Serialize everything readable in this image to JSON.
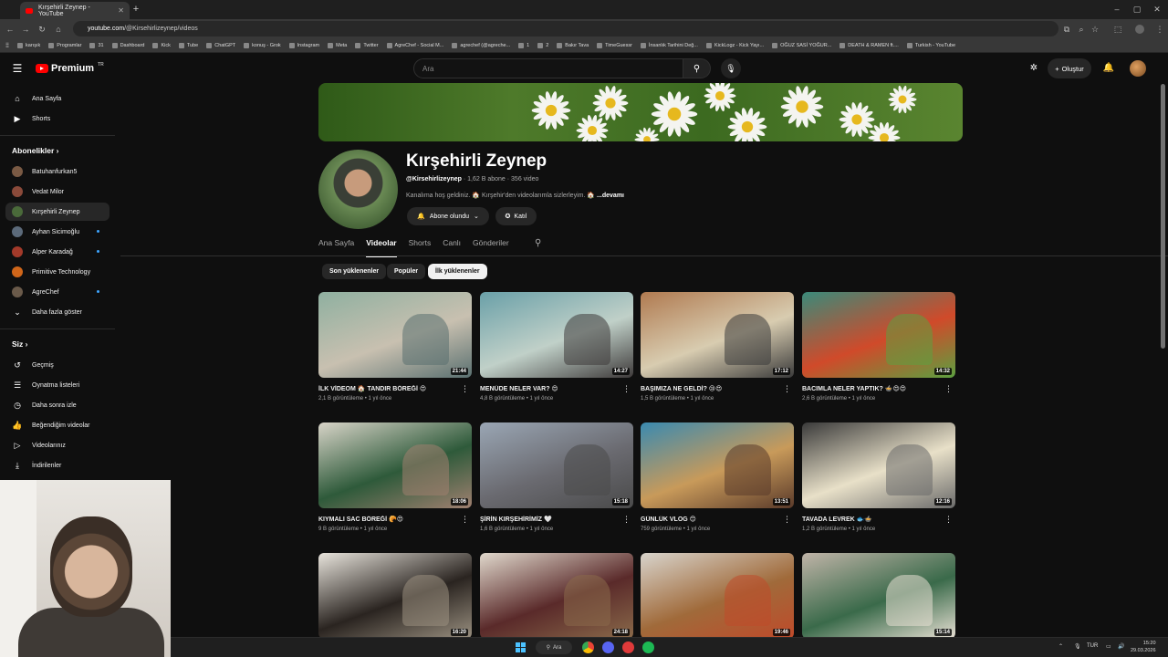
{
  "browser": {
    "tab_title": "Kırşehirli Zeynep - YouTube",
    "new_tab": "+",
    "url_host": "youtube.com",
    "url_path": "/@Kirsehirlizeynep/videos",
    "window_controls": {
      "minimize": "–",
      "maximize": "▢",
      "close": "✕"
    },
    "bookmarks": [
      "karışık",
      "Programlar",
      "31",
      "Dashboard",
      "Kick",
      "Tube",
      "ChatGPT",
      "konuş - Grok",
      "Instagram",
      "Meta",
      "Twitter",
      "AgreChef - Social M...",
      "agrechef (@agreche...",
      "1",
      "2",
      "Bakır Tava",
      "TimeGuessr",
      "İnsanlık Tarihini Değ...",
      "KickLogz - Kick Yayı...",
      "OĞUZ SASİ YOĞUR...",
      "DEATH & RAMEN ft....",
      "Turkish - YouTube"
    ]
  },
  "masthead": {
    "logo_text": "Premium",
    "logo_region": "TR",
    "search_placeholder": "Ara",
    "create_label": "Oluştur"
  },
  "sidebar": {
    "main": [
      {
        "label": "Ana Sayfa",
        "icon": "home-icon"
      },
      {
        "label": "Shorts",
        "icon": "shorts-icon"
      }
    ],
    "subs_heading": "Abonelikler",
    "subscriptions": [
      {
        "label": "Batuhanfurkan5",
        "color": "#7a5a44",
        "new": false
      },
      {
        "label": "Vedat Milor",
        "color": "#8a4a3a",
        "new": false
      },
      {
        "label": "Kırşehirli Zeynep",
        "color": "#4a6a3a",
        "new": false,
        "active": true
      },
      {
        "label": "Ayhan Sicimoğlu",
        "color": "#5c6a7a",
        "new": true
      },
      {
        "label": "Alper Karadağ",
        "color": "#a33a2a",
        "new": true
      },
      {
        "label": "Primitive Technology",
        "color": "#d0661a",
        "new": false
      },
      {
        "label": "AgreChef",
        "color": "#6a5a4a",
        "new": true
      }
    ],
    "show_more": "Daha fazla göster",
    "you_heading": "Siz",
    "you_items": [
      {
        "label": "Geçmiş",
        "icon": "history-icon"
      },
      {
        "label": "Oynatma listeleri",
        "icon": "playlists-icon"
      },
      {
        "label": "Daha sonra izle",
        "icon": "watch-later-icon"
      },
      {
        "label": "Beğendiğim videolar",
        "icon": "liked-icon"
      },
      {
        "label": "Videolarınız",
        "icon": "your-videos-icon"
      },
      {
        "label": "İndirilenler",
        "icon": "downloads-icon"
      }
    ]
  },
  "channel": {
    "name": "Kırşehirli Zeynep",
    "handle": "@Kirsehirlizeynep",
    "subscribers": "1,62 B abone",
    "videos": "356 video",
    "description": "Kanalıma hoş geldiniz. 🏠 Kırşehir'den videolarımla sizlerleyim. 🏠",
    "more": "...devamı",
    "subscribe_label": "Abone olundu",
    "join_label": "Katıl",
    "tabs": [
      {
        "label": "Ana Sayfa",
        "active": false
      },
      {
        "label": "Videolar",
        "active": true
      },
      {
        "label": "Shorts",
        "active": false
      },
      {
        "label": "Canlı",
        "active": false
      },
      {
        "label": "Gönderiler",
        "active": false
      }
    ],
    "chips": [
      {
        "label": "Son yüklenenler",
        "selected": false
      },
      {
        "label": "Popüler",
        "selected": false
      },
      {
        "label": "İlk yüklenenler",
        "selected": true
      }
    ]
  },
  "videos": [
    {
      "title": "İLK VİDEOM 🏠 TANDIR BÖREĞİ 😍",
      "views": "2,1 B görüntüleme",
      "age": "1 yıl önce",
      "duration": "21:44",
      "colors": [
        "#8fb0a0",
        "#c8c0b0",
        "#5a7070"
      ]
    },
    {
      "title": "MENÜDE NELER VAR? 😍",
      "views": "4,8 B görüntüleme",
      "age": "1 yıl önce",
      "duration": "14:27",
      "colors": [
        "#6aa0a8",
        "#c0d0c8",
        "#3e3a3a"
      ]
    },
    {
      "title": "BAŞIMIZA NE GELDİ? 😢😍",
      "views": "1,5 B görüntüleme",
      "age": "1 yıl önce",
      "duration": "17:12",
      "colors": [
        "#b07a50",
        "#d8ccb0",
        "#3a3a3a"
      ]
    },
    {
      "title": "BACIMLA NELER YAPTIK? 🍲😍😍",
      "views": "2,6 B görüntüleme",
      "age": "1 yıl önce",
      "duration": "14:32",
      "colors": [
        "#3a8a7a",
        "#d04a2a",
        "#5ca040"
      ]
    },
    {
      "title": "KIYMALI SAC BÖREĞİ 🥐😍",
      "views": "9 B görüntüleme",
      "age": "1 yıl önce",
      "duration": "18:06",
      "colors": [
        "#d8d4c8",
        "#2e5a3a",
        "#a08070"
      ]
    },
    {
      "title": "ŞİRİN KIRŞEHİRİMİZ 🤍",
      "views": "1,6 B görüntüleme",
      "age": "1 yıl önce",
      "duration": "15:18",
      "colors": [
        "#9aa6b4",
        "#6a6a70",
        "#4a4a4a"
      ]
    },
    {
      "title": "GÜNLÜK VLOG 😊",
      "views": "759 görüntüleme",
      "age": "1 yıl önce",
      "duration": "13:51",
      "colors": [
        "#3a8ab0",
        "#c89a5a",
        "#5a3a2a"
      ]
    },
    {
      "title": "TAVADA LEVREK 🐟🍲",
      "views": "1,2 B görüntüleme",
      "age": "1 yıl önce",
      "duration": "12:16",
      "colors": [
        "#3a3a3a",
        "#e8e0c8",
        "#6a6a6a"
      ]
    },
    {
      "title": "",
      "views": "",
      "age": "",
      "duration": "16:20",
      "colors": [
        "#e8e4dc",
        "#2a2420",
        "#9a9080"
      ]
    },
    {
      "title": "",
      "views": "",
      "age": "",
      "duration": "24:18",
      "colors": [
        "#e0d8cc",
        "#5a2a2a",
        "#8a6a4a"
      ]
    },
    {
      "title": "",
      "views": "",
      "age": "",
      "duration": "19:46",
      "colors": [
        "#d8d4cc",
        "#a06a3a",
        "#c04a2a"
      ]
    },
    {
      "title": "",
      "views": "",
      "age": "",
      "duration": "15:14",
      "colors": [
        "#c0b4a8",
        "#3a6a4a",
        "#e8e0d4"
      ]
    }
  ],
  "taskbar": {
    "search_label": "Ara",
    "lang": "TUR",
    "time": "15:20",
    "date": "29.03.2026"
  },
  "colors": {
    "background": "#0f0f0f",
    "youtube_red": "#ff0000",
    "accent": "#3ea6ff"
  }
}
